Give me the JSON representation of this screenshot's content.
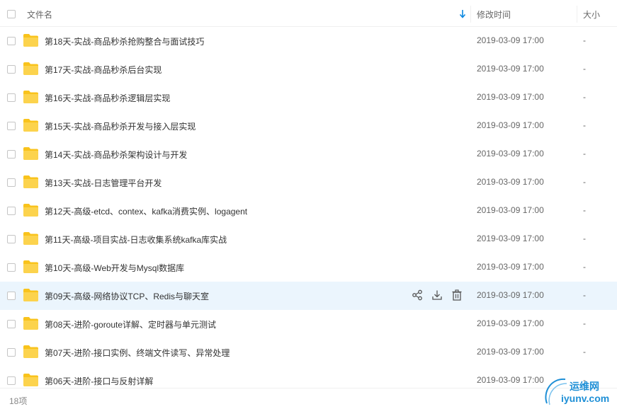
{
  "header": {
    "name_label": "文件名",
    "time_label": "修改时间",
    "size_label": "大小"
  },
  "rows": [
    {
      "name": "第18天-实战-商品秒杀抢购整合与面试技巧",
      "time": "2019-03-09 17:00",
      "size": "-"
    },
    {
      "name": "第17天-实战-商品秒杀后台实现",
      "time": "2019-03-09 17:00",
      "size": "-"
    },
    {
      "name": "第16天-实战-商品秒杀逻辑层实现",
      "time": "2019-03-09 17:00",
      "size": "-"
    },
    {
      "name": "第15天-实战-商品秒杀开发与接入层实现",
      "time": "2019-03-09 17:00",
      "size": "-"
    },
    {
      "name": "第14天-实战-商品秒杀架构设计与开发",
      "time": "2019-03-09 17:00",
      "size": "-"
    },
    {
      "name": "第13天-实战-日志管理平台开发",
      "time": "2019-03-09 17:00",
      "size": "-"
    },
    {
      "name": "第12天-高级-etcd、contex、kafka消费实例、logagent",
      "time": "2019-03-09 17:00",
      "size": "-"
    },
    {
      "name": "第11天-高级-项目实战-日志收集系统kafka库实战",
      "time": "2019-03-09 17:00",
      "size": "-"
    },
    {
      "name": "第10天-高级-Web开发与Mysql数据库",
      "time": "2019-03-09 17:00",
      "size": "-"
    },
    {
      "name": "第09天-高级-网络协议TCP、Redis与聊天室",
      "time": "2019-03-09 17:00",
      "size": "-"
    },
    {
      "name": "第08天-进阶-goroute详解、定时器与单元测试",
      "time": "2019-03-09 17:00",
      "size": "-"
    },
    {
      "name": "第07天-进阶-接口实例、终端文件读写、异常处理",
      "time": "2019-03-09 17:00",
      "size": "-"
    },
    {
      "name": "第06天-进阶-接口与反射详解",
      "time": "2019-03-09 17:00",
      "size": "-"
    }
  ],
  "hovered_row": 9,
  "footer": {
    "count": "18项"
  },
  "watermark": {
    "line1": "运维网",
    "line2": "iyunv.com"
  },
  "colors": {
    "folder": "#f9c31c",
    "accent": "#0b87e0",
    "hover": "#ebf5fd"
  },
  "icons": {
    "sort": "arrow-down-icon",
    "folder": "folder-icon",
    "share": "share-icon",
    "download": "download-icon",
    "delete": "trash-icon"
  }
}
